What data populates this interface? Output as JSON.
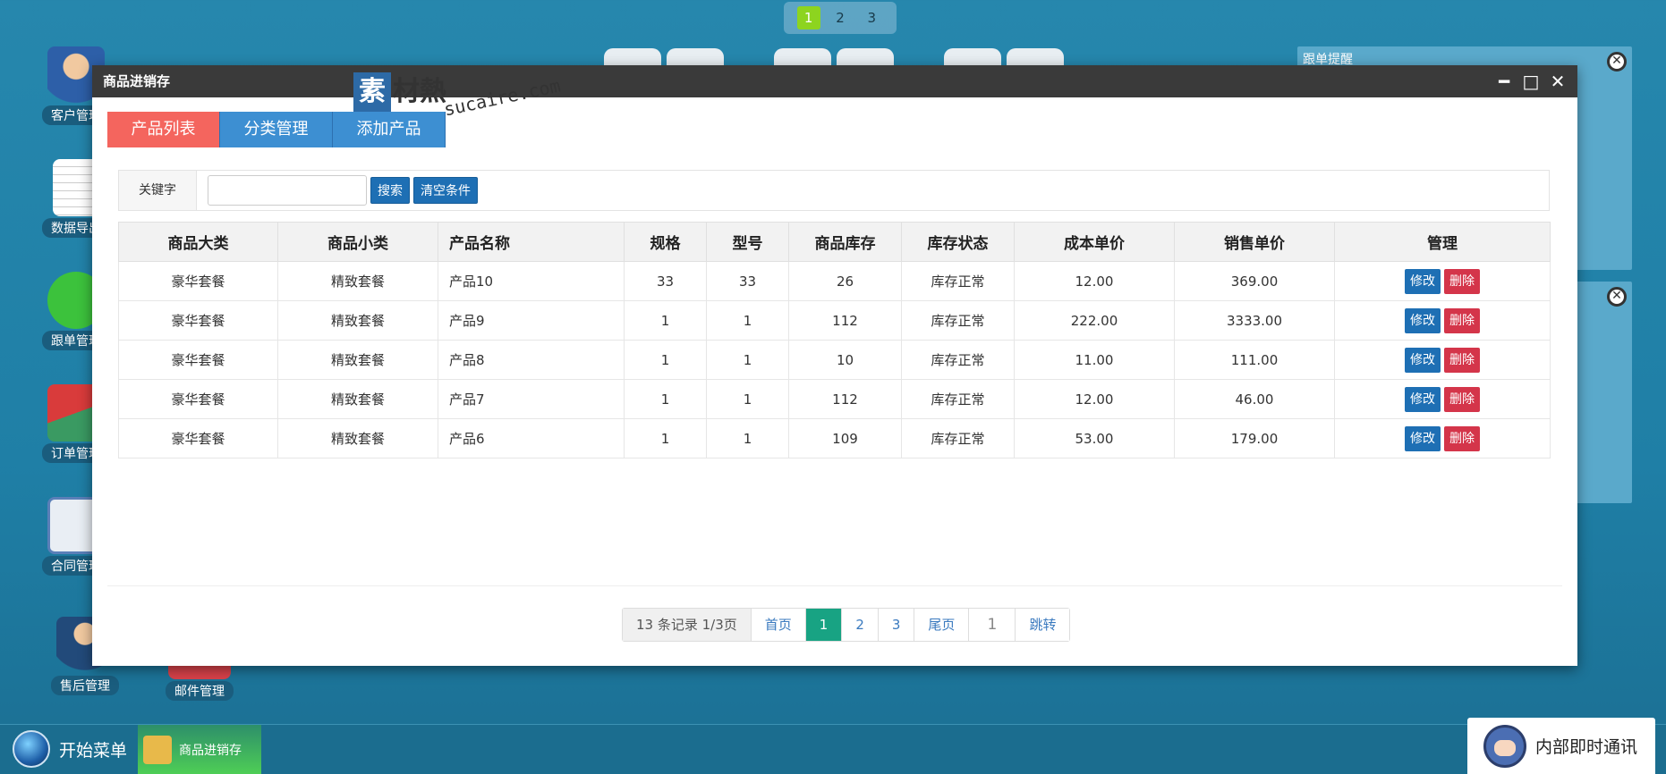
{
  "desktop": {
    "pager": [
      "1",
      "2",
      "3"
    ],
    "pager_active": 0,
    "icons": [
      {
        "label": "客户管理",
        "name": "customer-management"
      },
      {
        "label": "数据导出",
        "name": "data-export"
      },
      {
        "label": "跟单管理",
        "name": "followup-management"
      },
      {
        "label": "订单管理",
        "name": "order-management"
      },
      {
        "label": "合同管理",
        "name": "contract-management"
      },
      {
        "label": "售后管理",
        "name": "aftersales-management"
      },
      {
        "label": "邮件管理",
        "name": "mail-management"
      }
    ],
    "side_panel_title": "跟单提醒"
  },
  "window": {
    "title": "商品进销存",
    "controls": {
      "minimize": "━",
      "maximize": "□",
      "close": "✕"
    },
    "watermark": {
      "box": "素",
      "text": "材熱",
      "url": "sucaire.com"
    },
    "tabs": [
      {
        "label": "产品列表",
        "active": true
      },
      {
        "label": "分类管理",
        "active": false
      },
      {
        "label": "添加产品",
        "active": false
      }
    ],
    "search": {
      "keyword_label": "关键字",
      "input_value": "",
      "search_button": "搜索",
      "clear_button": "清空条件"
    },
    "table": {
      "headers": [
        "商品大类",
        "商品小类",
        "产品名称",
        "规格",
        "型号",
        "商品库存",
        "库存状态",
        "成本单价",
        "销售单价",
        "管理"
      ],
      "edit_label": "修改",
      "delete_label": "删除",
      "rows": [
        [
          "豪华套餐",
          "精致套餐",
          "产品10",
          "33",
          "33",
          "26",
          "库存正常",
          "12.00",
          "369.00"
        ],
        [
          "豪华套餐",
          "精致套餐",
          "产品9",
          "1",
          "1",
          "112",
          "库存正常",
          "222.00",
          "3333.00"
        ],
        [
          "豪华套餐",
          "精致套餐",
          "产品8",
          "1",
          "1",
          "10",
          "库存正常",
          "11.00",
          "111.00"
        ],
        [
          "豪华套餐",
          "精致套餐",
          "产品7",
          "1",
          "1",
          "112",
          "库存正常",
          "12.00",
          "46.00"
        ],
        [
          "豪华套餐",
          "精致套餐",
          "产品6",
          "1",
          "1",
          "109",
          "库存正常",
          "53.00",
          "179.00"
        ]
      ]
    },
    "pagination": {
      "info": "13 条记录 1/3页",
      "first": "首页",
      "pages": [
        "1",
        "2",
        "3"
      ],
      "current": "1",
      "last": "尾页",
      "jump_value": "1",
      "jump": "跳转"
    }
  },
  "taskbar": {
    "start_label": "开始菜单",
    "task_label": "商品进销存",
    "im_label": "内部即时通讯"
  },
  "colors": {
    "desktop_bg": "#2687ad",
    "tab_active": "#f4655e",
    "tab_inactive": "#3d8fd2",
    "button_blue": "#1e6fb4",
    "button_red": "#d4354a",
    "page_current": "#18a383"
  }
}
